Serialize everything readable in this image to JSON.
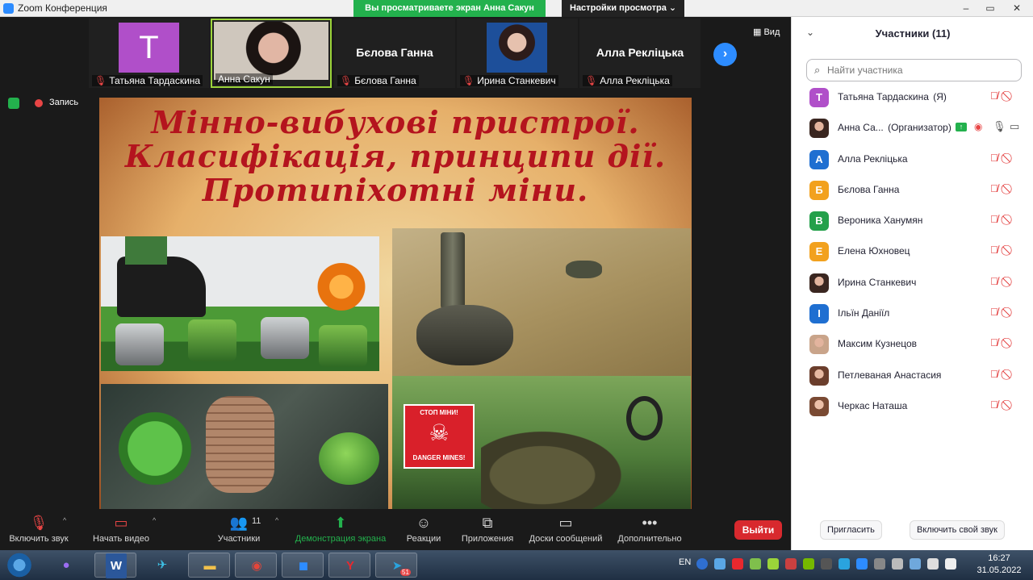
{
  "window": {
    "title": "Zoom Конференция",
    "share_banner": "Вы просматриваете экран Анна Сакун",
    "view_settings": "Настройки просмотра",
    "minimize": "–",
    "maximize": "▭",
    "close": "✕"
  },
  "video_strip": {
    "tiles": [
      {
        "name": "Татьяна Тардаскина",
        "avatar_letter": "T"
      },
      {
        "name": "Анна Сакун"
      },
      {
        "name": "Бєлова Ганна",
        "display_name": "Бєлова Ганна"
      },
      {
        "name": "Ирина Станкевич"
      },
      {
        "name": "Алла Рекліцька",
        "display_name": "Алла Рекліцька"
      }
    ],
    "view_label": "Вид",
    "next_icon": "chevron-right-icon"
  },
  "recording": {
    "label": "Запись"
  },
  "slide": {
    "title_lines": [
      "Мінно-вибухові пристрої.",
      "Класифікація, принципи дії.",
      "Протипіхотні міни."
    ],
    "sign_top": "СТОП МІНИ!",
    "sign_bottom": "DANGER MINES!",
    "sign_icon": "skull-icon"
  },
  "participants": {
    "title": "Участники (11)",
    "search_placeholder": "Найти участника",
    "list": [
      {
        "name": "Татьяна Тардаскина",
        "suffix": "(Я)",
        "letter": "T",
        "color": "#b04fc9"
      },
      {
        "name": "Анна Са...",
        "suffix": "(Организатор)",
        "photo": true
      },
      {
        "name": "Алла Рекліцька",
        "letter": "А",
        "color": "#1f6fd1"
      },
      {
        "name": "Бєлова Ганна",
        "letter": "Б",
        "color": "#f2a11e"
      },
      {
        "name": "Вероника Ханумян",
        "letter": "В",
        "color": "#23a04a"
      },
      {
        "name": "Елена Юхновец",
        "letter": "Е",
        "color": "#f2a11e"
      },
      {
        "name": "Ирина Станкевич",
        "photo": true
      },
      {
        "name": "Ільїн Даніїл",
        "letter": "І",
        "color": "#1f6fd1"
      },
      {
        "name": "Максим Кузнецов",
        "photo": true
      },
      {
        "name": "Петлеваная Анастасия",
        "photo": true
      },
      {
        "name": "Черкас Наташа",
        "photo": true
      }
    ],
    "invite_label": "Пригласить",
    "unmute_me_label": "Включить свой звук"
  },
  "toolbar": {
    "unmute_label": "Включить звук",
    "start_video_label": "Начать видео",
    "participants_label": "Участники",
    "participants_count": "11",
    "share_label": "Демонстрация экрана",
    "reactions_label": "Реакции",
    "apps_label": "Приложения",
    "whiteboards_label": "Доски сообщений",
    "more_label": "Дополнительно",
    "leave_label": "Выйти"
  },
  "taskbar": {
    "lang": "EN",
    "time": "16:27",
    "date": "31.05.2022",
    "apps": [
      "yandex-browser",
      "word",
      "bird-app",
      "file-explorer",
      "chrome",
      "zoom",
      "yandex",
      "telegram"
    ],
    "telegram_badge": "51"
  },
  "colors": {
    "accent": "#2d8cff",
    "share_green": "#23b14d",
    "leave_red": "#d8292e",
    "muted_red": "#e02828",
    "slide_title_red": "#b4141e"
  }
}
